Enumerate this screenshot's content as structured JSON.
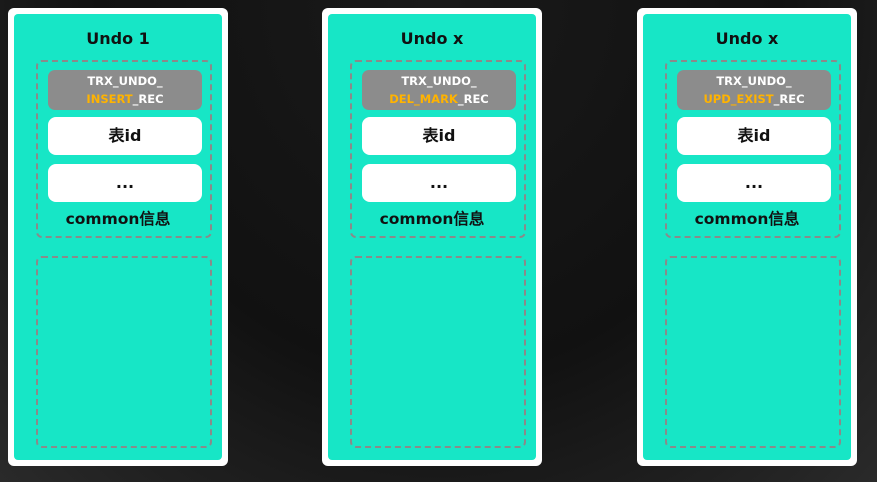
{
  "cards": [
    {
      "title": "Undo 1",
      "type_line1": "TRX_UNDO_",
      "type_highlight": "INSERT",
      "type_suffix": "_REC",
      "field1": "表id",
      "field2": "...",
      "common": "common信息"
    },
    {
      "title": "Undo x",
      "type_line1": "TRX_UNDO_",
      "type_highlight": "DEL_MARK",
      "type_suffix": "_REC",
      "field1": "表id",
      "field2": "...",
      "common": "common信息"
    },
    {
      "title": "Undo x",
      "type_line1": "TRX_UNDO_",
      "type_highlight": "UPD_EXIST",
      "type_suffix": "_REC",
      "field1": "表id",
      "field2": "...",
      "common": "common信息"
    }
  ],
  "colors": {
    "card_fill": "#17e6c6",
    "card_border": "#ffffff",
    "type_box_fill": "#8c8c8c",
    "highlight_text": "#ffb300",
    "dashed_border": "#8a8a8a",
    "background": "#151515"
  }
}
